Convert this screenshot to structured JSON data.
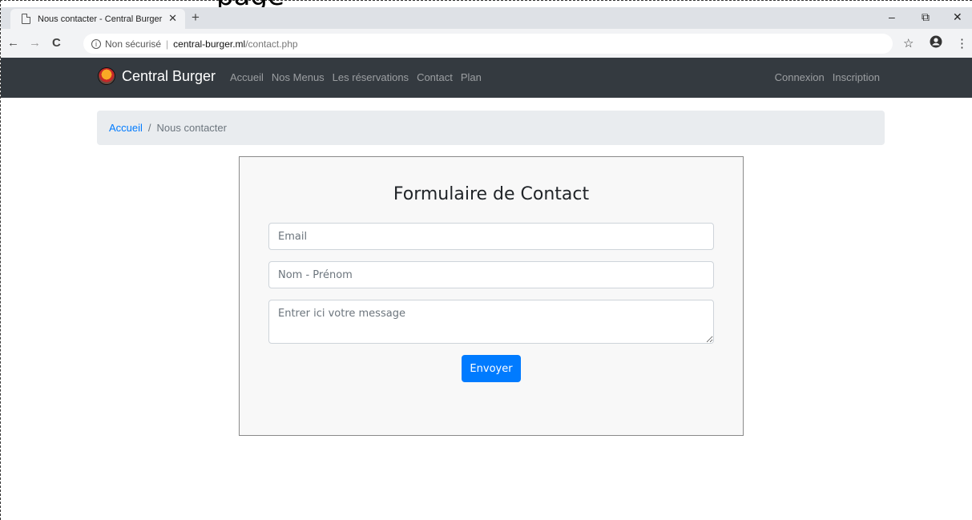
{
  "caption_fragment": "page",
  "browser": {
    "tab_title": "Nous contacter - Central Burger",
    "tab_close": "✕",
    "new_tab": "+",
    "security_label": "Non sécurisé",
    "url_host": "central-burger.ml",
    "url_path": "/contact.php",
    "back": "←",
    "forward": "→",
    "reload": "C",
    "minimize": "–",
    "restore": "⧉",
    "close": "✕",
    "bookmark": "☆",
    "menu": "⋮"
  },
  "navbar": {
    "brand": "Central Burger",
    "links": [
      "Accueil",
      "Nos Menus",
      "Les réservations",
      "Contact",
      "Plan"
    ],
    "right_links": [
      "Connexion",
      "Inscription"
    ]
  },
  "breadcrumb": {
    "home": "Accueil",
    "separator": "/",
    "current": "Nous contacter"
  },
  "form": {
    "title": "Formulaire de Contact",
    "email_placeholder": "Email",
    "name_placeholder": "Nom - Prénom",
    "message_placeholder": "Entrer ici votre message",
    "submit_label": "Envoyer"
  },
  "colors": {
    "navbar_bg": "#343a40",
    "primary": "#007bff",
    "breadcrumb_bg": "#e9ecef"
  }
}
